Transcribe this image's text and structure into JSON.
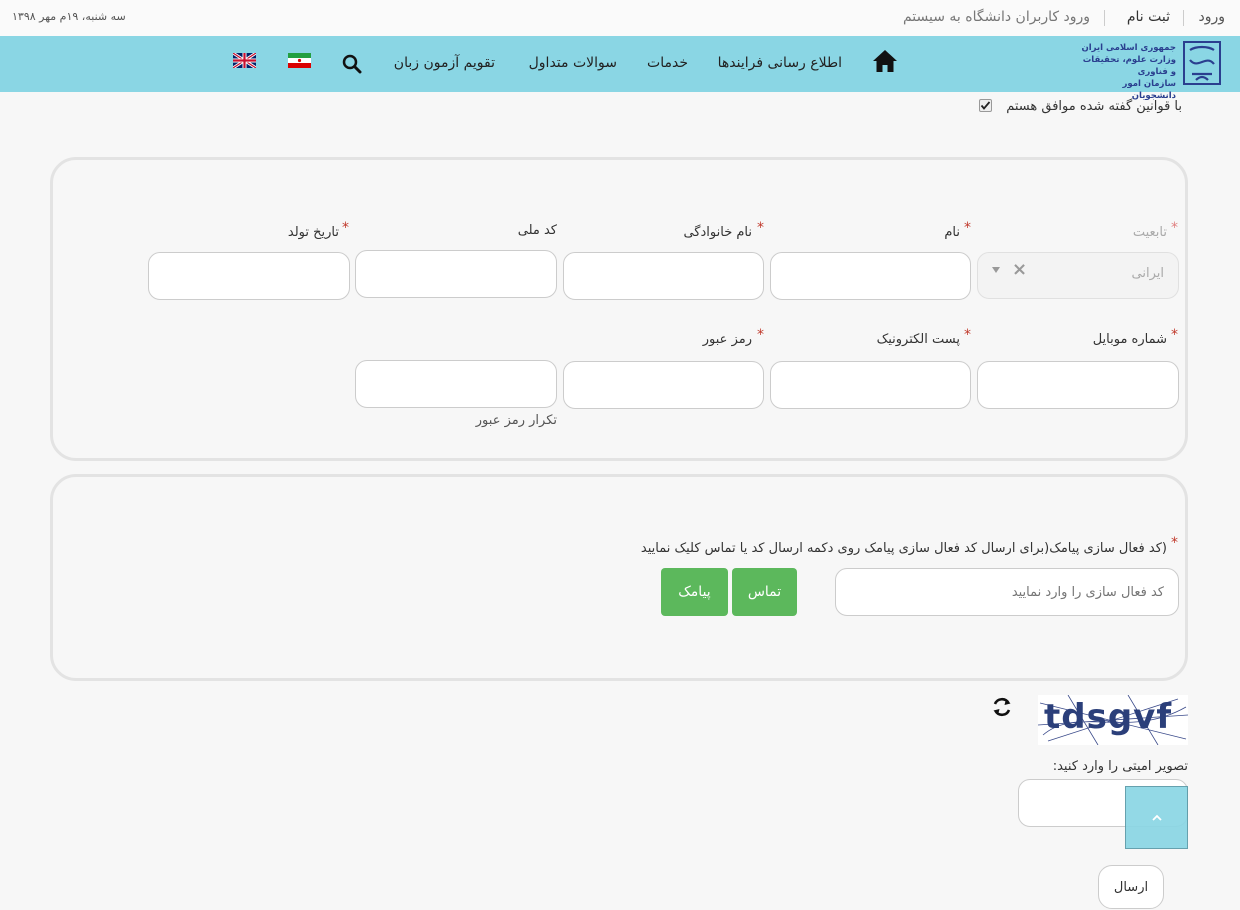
{
  "top": {
    "login": "ورود",
    "register": "ثبت نام",
    "login_university_users": "ورود کاربران دانشگاه به سیستم",
    "date": "سه شنبه، ۱۹م مهر ۱۳۹۸"
  },
  "logo": {
    "line1": "جمهوری اسلامی ایران",
    "line2": "وزارت علوم، تحقیقات و فناوری",
    "line3": "سازمان امور دانشجویان"
  },
  "nav": {
    "home_icon": "home-icon",
    "items": [
      "اطلاع رسانی فرایندها",
      "خدمات",
      "سوالات متداول",
      "تقویم آزمون زبان"
    ],
    "search_icon": "search-icon",
    "flag_iran": "flag-iran-icon",
    "flag_uk": "flag-uk-icon"
  },
  "agree": {
    "label": "با قوانین گفته شده موافق هستم",
    "checked": true
  },
  "form": {
    "nationality_label": "تابعیت",
    "nationality_value": "ایرانی",
    "first_name_label": "نام",
    "last_name_label": "نام خانوادگی",
    "national_code_label": "کد ملی",
    "birth_date_label": "تاریخ تولد",
    "mobile_label": "شماره موبایل",
    "email_label": "پست الکترونیک",
    "password_label": "رمز عبور",
    "password_repeat_label": "تکرار رمز عبور"
  },
  "activation": {
    "label": "(کد فعال سازی پیامک(برای ارسال کد فعال سازی پیامک روی دکمه ارسال کد یا تماس کلیک نمایید",
    "placeholder": "کد فعال سازی را وارد نمایید",
    "call_button": "تماس",
    "sms_button": "پیامک"
  },
  "captcha": {
    "image_text": "tdsgvf",
    "refresh_icon": "refresh-icon",
    "label": "تصویر امیتی را وارد کنید:"
  },
  "submit_label": "ارسال",
  "scroll_top_icon": "chevron-up-icon",
  "colors": {
    "nav_bg": "#8ad6e4",
    "accent_green": "#5cb85c",
    "required_star": "#c0392b",
    "scroll_btn": "#8ad6e4"
  }
}
